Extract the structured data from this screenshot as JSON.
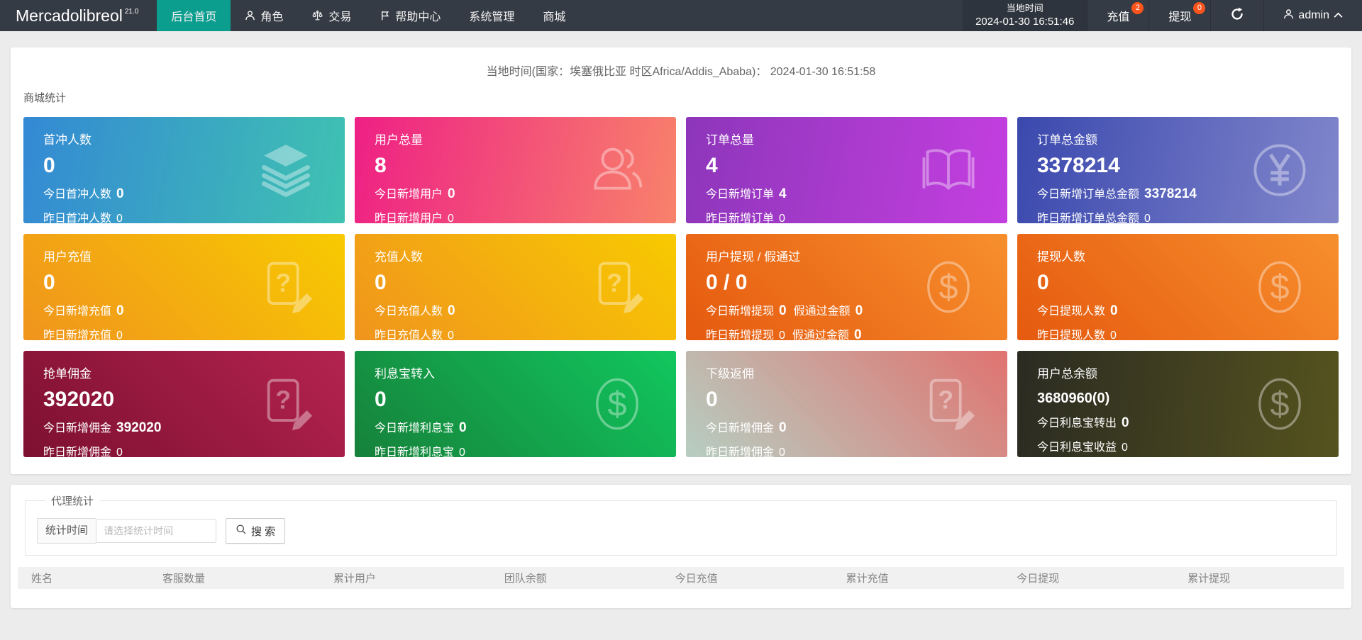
{
  "colors": {
    "header_bg": "#353b44",
    "header_time_bg": "#2e343d",
    "accent_teal": "#0b9d8e",
    "badge": "#fa541c",
    "page_bg": "#ececec"
  },
  "header": {
    "logo": "Mercadolibreol",
    "version": "21.0",
    "nav": [
      {
        "label": "后台首页",
        "icon": null,
        "active": true
      },
      {
        "label": "角色",
        "icon": "user-icon",
        "active": false
      },
      {
        "label": "交易",
        "icon": "scales-icon",
        "active": false
      },
      {
        "label": "帮助中心",
        "icon": "flag-icon",
        "active": false
      },
      {
        "label": "系统管理",
        "icon": null,
        "active": false
      },
      {
        "label": "商城",
        "icon": null,
        "active": false
      }
    ],
    "local_time_label": "当地时间",
    "local_time_value": "2024-01-30 16:51:46",
    "recharge": {
      "label": "充值",
      "badge": "2"
    },
    "withdraw": {
      "label": "提现",
      "badge": "0"
    },
    "refresh_icon": "refresh-icon",
    "user": {
      "name": "admin",
      "icon": "user-icon",
      "chevron": "chevron-up-icon"
    }
  },
  "main": {
    "timezone_line": "当地时间(国家：埃塞俄比亚 时区Africa/Addis_Ababa)： 2024-01-30 16:51:58",
    "section_title": "商城统计",
    "cards": [
      {
        "title": "首冲人数",
        "value": "0",
        "icon": "layers-icon",
        "angle": 100,
        "gradient": [
          "#3489d4",
          "#3fc2b1"
        ],
        "lines": [
          [
            {
              "t": "今日首冲人数"
            },
            {
              "v": "0",
              "b": true
            }
          ],
          [
            {
              "t": "昨日首冲人数"
            },
            {
              "v": "0",
              "b": false
            }
          ]
        ]
      },
      {
        "title": "用户总量",
        "value": "8",
        "icon": "users-icon",
        "angle": 100,
        "gradient": [
          "#ee2085",
          "#f8826b"
        ],
        "lines": [
          [
            {
              "t": "今日新增用户"
            },
            {
              "v": "0",
              "b": true
            }
          ],
          [
            {
              "t": "昨日新增用户"
            },
            {
              "v": "0",
              "b": false
            }
          ]
        ]
      },
      {
        "title": "订单总量",
        "value": "4",
        "icon": "book-icon",
        "angle": 100,
        "gradient": [
          "#8d36ba",
          "#c43fe0"
        ],
        "lines": [
          [
            {
              "t": "今日新增订单"
            },
            {
              "v": "4",
              "b": true
            }
          ],
          [
            {
              "t": "昨日新增订单"
            },
            {
              "v": "0",
              "b": false
            }
          ]
        ]
      },
      {
        "title": "订单总金额",
        "value": "3378214",
        "icon": "yen-circle-icon",
        "angle": 100,
        "gradient": [
          "#3b49ae",
          "#8186cb"
        ],
        "lines": [
          [
            {
              "t": "今日新增订单总金额"
            },
            {
              "v": "3378214",
              "b": true
            }
          ],
          [
            {
              "t": "昨日新增订单总金额"
            },
            {
              "v": "0",
              "b": false
            }
          ]
        ]
      },
      {
        "title": "用户充值",
        "value": "0",
        "icon": "doc-question-icon",
        "angle": 45,
        "gradient": [
          "#f0941d",
          "#f8ca01"
        ],
        "lines": [
          [
            {
              "t": "今日新增充值"
            },
            {
              "v": "0",
              "b": true
            }
          ],
          [
            {
              "t": "昨日新增充值"
            },
            {
              "v": "0",
              "b": false
            }
          ]
        ]
      },
      {
        "title": "充值人数",
        "value": "0",
        "icon": "doc-question-icon",
        "angle": 45,
        "gradient": [
          "#f0941d",
          "#f8ca01"
        ],
        "lines": [
          [
            {
              "t": "今日充值人数"
            },
            {
              "v": "0",
              "b": true
            }
          ],
          [
            {
              "t": "昨日充值人数"
            },
            {
              "v": "0",
              "b": false
            }
          ]
        ]
      },
      {
        "title": "用户提现 / 假通过",
        "value": "0 / 0",
        "icon": "dollar-circle-icon",
        "angle": 45,
        "gradient": [
          "#e55a0f",
          "#f78f2d"
        ],
        "lines": [
          [
            {
              "t": "今日新增提现"
            },
            {
              "v": "0",
              "b": true
            },
            {
              "t": "假通过金额"
            },
            {
              "v": "0",
              "b": true
            }
          ],
          [
            {
              "t": "昨日新增提现"
            },
            {
              "v": "0",
              "b": false
            },
            {
              "t": "假通过金额"
            },
            {
              "v": "0",
              "b": true
            }
          ]
        ]
      },
      {
        "title": "提现人数",
        "value": "0",
        "icon": "dollar-circle-icon",
        "angle": 45,
        "gradient": [
          "#e55a0f",
          "#f78f2d"
        ],
        "lines": [
          [
            {
              "t": "今日提现人数"
            },
            {
              "v": "0",
              "b": true
            }
          ],
          [
            {
              "t": "昨日提现人数"
            },
            {
              "v": "0",
              "b": false
            }
          ]
        ]
      },
      {
        "title": "抢单佣金",
        "value": "392020",
        "icon": "doc-question-icon",
        "angle": 45,
        "gradient": [
          "#7d1031",
          "#b42350"
        ],
        "lines": [
          [
            {
              "t": "今日新增佣金"
            },
            {
              "v": "392020",
              "b": true
            }
          ],
          [
            {
              "t": "昨日新增佣金"
            },
            {
              "v": "0",
              "b": false
            }
          ]
        ]
      },
      {
        "title": "利息宝转入",
        "value": "0",
        "icon": "dollar-circle-icon",
        "angle": 45,
        "gradient": [
          "#16813a",
          "#11c75e"
        ],
        "lines": [
          [
            {
              "t": "今日新增利息宝"
            },
            {
              "v": "0",
              "b": true
            }
          ],
          [
            {
              "t": "昨日新增利息宝"
            },
            {
              "v": "0",
              "b": false
            }
          ]
        ]
      },
      {
        "title": "下级返佣",
        "value": "0",
        "icon": "doc-question-icon",
        "angle": 45,
        "gradient": [
          "#b6cec1",
          "#e07370"
        ],
        "lines": [
          [
            {
              "t": "今日新增佣金"
            },
            {
              "v": "0",
              "b": true
            }
          ],
          [
            {
              "t": "昨日新增佣金"
            },
            {
              "v": "0",
              "b": false
            }
          ]
        ]
      },
      {
        "title": "用户总余额",
        "value": "3680960(0)",
        "small_value": true,
        "icon": "dollar-circle-icon",
        "angle": 95,
        "gradient": [
          "#2b2b22",
          "#55531e"
        ],
        "lines": [
          [
            {
              "t": "今日利息宝转出"
            },
            {
              "v": "0",
              "b": true
            }
          ],
          [
            {
              "t": "今日利息宝收益"
            },
            {
              "v": "0",
              "b": false
            }
          ]
        ]
      }
    ]
  },
  "agent": {
    "legend": "代理统计",
    "time_label": "统计时间",
    "time_placeholder": "请选择统计时间",
    "search_label": "搜 索",
    "search_icon": "magnifier-icon",
    "table_headers": [
      "姓名",
      "客服数量",
      "累计用户",
      "团队余额",
      "今日充值",
      "累计充值",
      "今日提现",
      "累计提现"
    ]
  }
}
